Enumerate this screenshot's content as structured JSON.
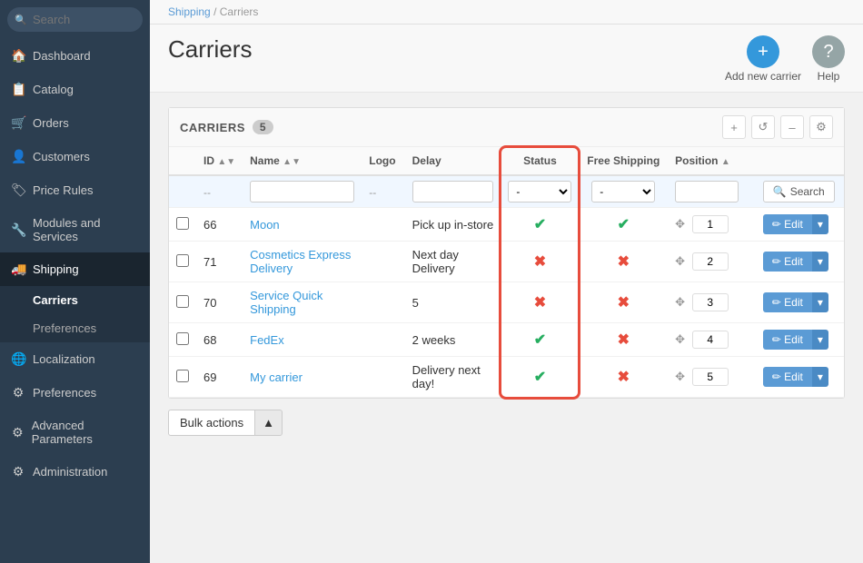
{
  "sidebar": {
    "search_placeholder": "Search",
    "items": [
      {
        "id": "dashboard",
        "label": "Dashboard",
        "icon": "🏠"
      },
      {
        "id": "catalog",
        "label": "Catalog",
        "icon": "📋"
      },
      {
        "id": "orders",
        "label": "Orders",
        "icon": "🛒"
      },
      {
        "id": "customers",
        "label": "Customers",
        "icon": "👤"
      },
      {
        "id": "price-rules",
        "label": "Price Rules",
        "icon": "🏷"
      },
      {
        "id": "modules",
        "label": "Modules and Services",
        "icon": "🔧"
      },
      {
        "id": "shipping",
        "label": "Shipping",
        "icon": "🚚",
        "active": true
      },
      {
        "id": "localization",
        "label": "Localization",
        "icon": "🌐"
      },
      {
        "id": "preferences",
        "label": "Preferences",
        "icon": "⚙"
      },
      {
        "id": "advanced-params",
        "label": "Advanced Parameters",
        "icon": "⚙"
      },
      {
        "id": "administration",
        "label": "Administration",
        "icon": "⚙"
      }
    ],
    "shipping_subitems": [
      {
        "id": "carriers",
        "label": "Carriers",
        "active": true
      },
      {
        "id": "preferences",
        "label": "Preferences"
      }
    ]
  },
  "breadcrumb": {
    "parent": "Shipping",
    "current": "Carriers"
  },
  "page": {
    "title": "Carriers"
  },
  "header_actions": [
    {
      "id": "add-new-carrier",
      "label": "Add new carrier",
      "icon": "+",
      "color": "circle-blue"
    },
    {
      "id": "help",
      "label": "Help",
      "icon": "?",
      "color": "circle-gray"
    }
  ],
  "table": {
    "panel_title": "CARRIERS",
    "count": "5",
    "columns": [
      "ID",
      "Name",
      "Logo",
      "Delay",
      "Status",
      "Free Shipping",
      "Position"
    ],
    "filter_placeholders": {
      "id": "--",
      "name": "",
      "delay": "--",
      "status": "-",
      "free_shipping": "-",
      "position": "",
      "search_btn": "Search"
    },
    "rows": [
      {
        "id": 66,
        "name": "Moon",
        "logo": "",
        "delay": "Pick up in-store",
        "status": true,
        "free_shipping": true,
        "position": 1
      },
      {
        "id": 71,
        "name": "Cosmetics Express Delivery",
        "logo": "",
        "delay": "Next day Delivery",
        "status": false,
        "free_shipping": false,
        "position": 2
      },
      {
        "id": 70,
        "name": "Service Quick Shipping",
        "logo": "",
        "delay": "5",
        "status": false,
        "free_shipping": false,
        "position": 3
      },
      {
        "id": 68,
        "name": "FedEx",
        "logo": "",
        "delay": "2 weeks",
        "status": true,
        "free_shipping": false,
        "position": 4
      },
      {
        "id": 69,
        "name": "My carrier",
        "logo": "",
        "delay": "Delivery next day!",
        "status": true,
        "free_shipping": false,
        "position": 5
      }
    ],
    "edit_btn_label": "Edit",
    "bulk_actions_label": "Bulk actions"
  }
}
